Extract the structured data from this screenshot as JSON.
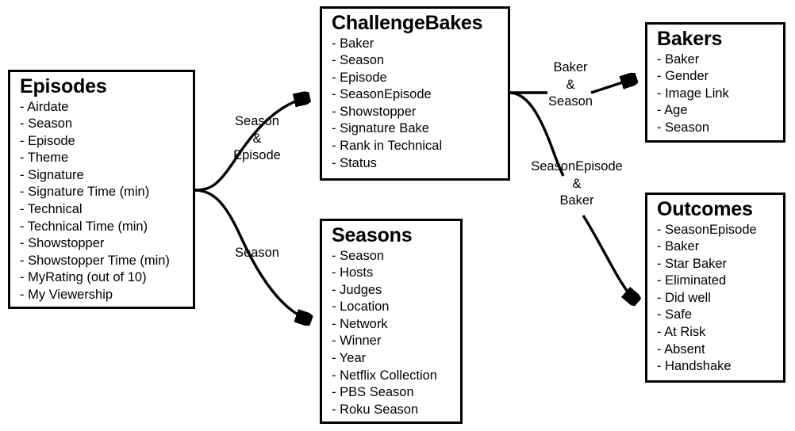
{
  "diagram": {
    "type": "entity-relationship-diagram",
    "entities": [
      {
        "id": "episodes",
        "title": "Episodes",
        "fields": [
          "Airdate",
          "Season",
          "Episode",
          "Theme",
          "Signature",
          "Signature Time (min)",
          "Technical",
          "Technical Time (min)",
          "Showstopper",
          "Showstopper Time (min)",
          "MyRating (out of 10)",
          "My Viewership"
        ]
      },
      {
        "id": "challengebakes",
        "title": "ChallengeBakes",
        "fields": [
          "Baker",
          "Season",
          "Episode",
          "SeasonEpisode",
          "Showstopper",
          "Signature Bake",
          "Rank in Technical",
          "Status"
        ]
      },
      {
        "id": "seasons",
        "title": "Seasons",
        "fields": [
          "Season",
          "Hosts",
          "Judges",
          "Location",
          "Network",
          "Winner",
          "Year",
          "Netflix Collection",
          "PBS Season",
          "Roku Season"
        ]
      },
      {
        "id": "bakers",
        "title": "Bakers",
        "fields": [
          "Baker",
          "Gender",
          "Image Link",
          "Age",
          "Season"
        ]
      },
      {
        "id": "outcomes",
        "title": "Outcomes",
        "fields": [
          "SeasonEpisode",
          "Baker",
          "Star Baker",
          "Eliminated",
          "Did well",
          "Safe",
          "At Risk",
          "Absent",
          "Handshake"
        ]
      }
    ],
    "relationships": [
      {
        "id": "episodes-to-challengebakes",
        "from": "episodes",
        "to": "challengebakes",
        "label_lines": [
          "Season",
          "&",
          "Episode"
        ]
      },
      {
        "id": "episodes-to-seasons",
        "from": "episodes",
        "to": "seasons",
        "label_lines": [
          "Season"
        ]
      },
      {
        "id": "challengebakes-to-bakers",
        "from": "challengebakes",
        "to": "bakers",
        "label_lines": [
          "Baker",
          "&",
          "Season"
        ]
      },
      {
        "id": "challengebakes-to-outcomes",
        "from": "challengebakes",
        "to": "outcomes",
        "label_lines": [
          "SeasonEpisode",
          "&",
          "Baker"
        ]
      }
    ],
    "colors": {
      "background": "#ffffff",
      "stroke": "#000000",
      "text": "#000000"
    }
  }
}
